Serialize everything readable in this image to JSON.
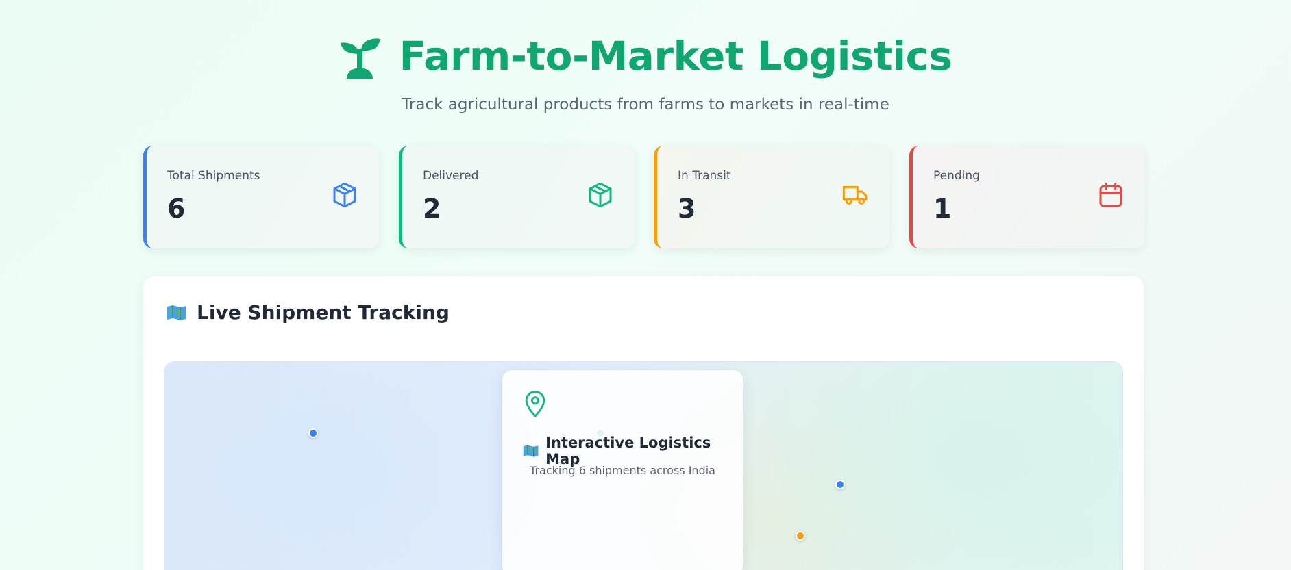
{
  "header": {
    "title": "Farm-to-Market Logistics",
    "subtitle": "Track agricultural products from farms to markets in real-time",
    "logo_icon": "sprout-icon",
    "title_color": "#10a66f"
  },
  "stats": [
    {
      "label": "Total Shipments",
      "value": "6",
      "icon": "package-icon",
      "accent": "#3b82f6"
    },
    {
      "label": "Delivered",
      "value": "2",
      "icon": "package-icon",
      "accent": "#10b981"
    },
    {
      "label": "In Transit",
      "value": "3",
      "icon": "truck-icon",
      "accent": "#f59e0b"
    },
    {
      "label": "Pending",
      "value": "1",
      "icon": "calendar-icon",
      "accent": "#ef4444"
    }
  ],
  "tracking": {
    "title": "Live Shipment Tracking",
    "title_icon": "world-map-icon",
    "map": {
      "pins": [
        {
          "status_color": "#3b82f6"
        },
        {
          "status_color": "#10b981"
        },
        {
          "status_color": "#3b82f6"
        },
        {
          "status_color": "#f59e0b"
        }
      ],
      "info": {
        "icon": "map-pin-icon",
        "title_icon": "world-map-icon",
        "title": "Interactive Logistics Map",
        "subtitle": "Tracking 6 shipments across India"
      }
    }
  }
}
